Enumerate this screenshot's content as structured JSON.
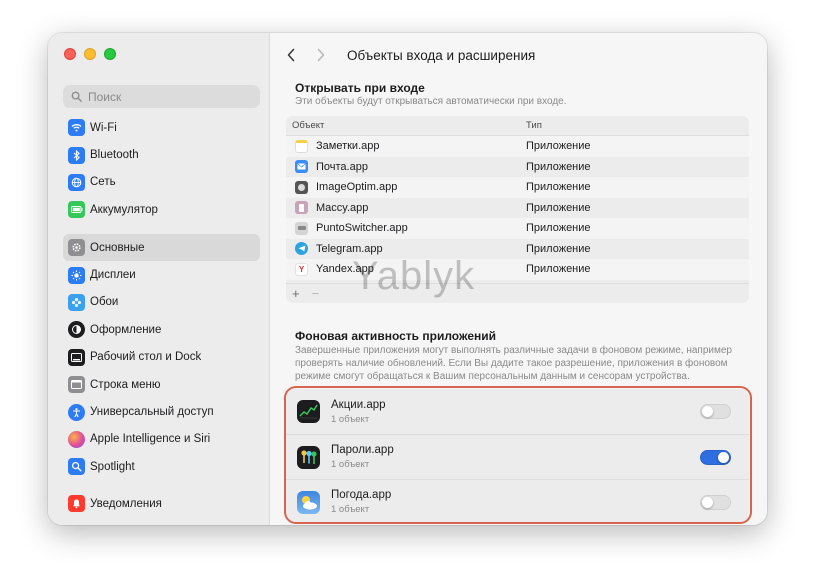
{
  "window": {
    "title": "Объекты входа и расширения"
  },
  "sidebar": {
    "search_placeholder": "Поиск",
    "group1": [
      {
        "label": "Wi-Fi",
        "icon": "wifi-icon",
        "color": "#2d7cf6"
      },
      {
        "label": "Bluetooth",
        "icon": "bluetooth-icon",
        "color": "#2d7cf6"
      },
      {
        "label": "Сеть",
        "icon": "globe-icon",
        "color": "#2d7cf6"
      },
      {
        "label": "Аккумулятор",
        "icon": "battery-icon",
        "color": "#34c759"
      }
    ],
    "group2": [
      {
        "label": "Основные",
        "icon": "gear-icon",
        "color": "#8e8e93",
        "selected": true
      },
      {
        "label": "Дисплеи",
        "icon": "sun-icon",
        "color": "#2d7cf6"
      },
      {
        "label": "Обои",
        "icon": "flower-icon",
        "color": "#3aa1f0"
      },
      {
        "label": "Оформление",
        "icon": "appearance-icon",
        "color": "#1d1d1f"
      },
      {
        "label": "Рабочий стол и Dock",
        "icon": "dock-icon",
        "color": "#1d1d1f"
      },
      {
        "label": "Строка меню",
        "icon": "menubar-icon",
        "color": "#8e8e93"
      },
      {
        "label": "Универсальный доступ",
        "icon": "accessibility-icon",
        "color": "#2d7cf6"
      },
      {
        "label": "Apple Intelligence и Siri",
        "icon": "siri-icon",
        "color": "#e04b9a"
      },
      {
        "label": "Spotlight",
        "icon": "spotlight-icon",
        "color": "#2d7cf6"
      }
    ],
    "group3": [
      {
        "label": "Уведомления",
        "icon": "bell-icon",
        "color": "#ff3b30"
      }
    ]
  },
  "open_at_login": {
    "title": "Открывать при входе",
    "subtitle": "Эти объекты будут открываться автоматически при входе.",
    "columns": [
      "Объект",
      "Тип"
    ],
    "rows": [
      {
        "name": "Заметки.app",
        "type": "Приложение",
        "icon": "notes-icon",
        "color": "#f5d24a"
      },
      {
        "name": "Почта.app",
        "type": "Приложение",
        "icon": "mail-icon",
        "color": "#3b8df5"
      },
      {
        "name": "ImageOptim.app",
        "type": "Приложение",
        "icon": "imageoptim-icon",
        "color": "#555555"
      },
      {
        "name": "Maccy.app",
        "type": "Приложение",
        "icon": "maccy-icon",
        "color": "#c9a3b8"
      },
      {
        "name": "PuntoSwitcher.app",
        "type": "Приложение",
        "icon": "punto-icon",
        "color": "#bfbfbf"
      },
      {
        "name": "Telegram.app",
        "type": "Приложение",
        "icon": "telegram-icon",
        "color": "#2aa3e0"
      },
      {
        "name": "Yandex.app",
        "type": "Приложение",
        "icon": "yandex-icon",
        "color": "#ffffff"
      }
    ],
    "add": "+",
    "remove": "−"
  },
  "background": {
    "title": "Фоновая активность приложений",
    "subtitle": "Завершенные приложения могут выполнять различные задачи в фоновом режиме, например проверять наличие обновлений. Если Вы дадите такое разрешение, приложения в фоновом режиме смогут обращаться к Вашим персональным данным и сенсорам устройства.",
    "items": [
      {
        "name": "Акции.app",
        "count": "1 объект",
        "enabled": false,
        "icon": "stocks-icon"
      },
      {
        "name": "Пароли.app",
        "count": "1 объект",
        "enabled": true,
        "icon": "passwords-icon"
      },
      {
        "name": "Погода.app",
        "count": "1 объект",
        "enabled": false,
        "icon": "weather-icon"
      }
    ]
  },
  "watermark": "Yablyk",
  "colors": {
    "accent": "#2f6ee0",
    "highlight": "#d9644e"
  }
}
